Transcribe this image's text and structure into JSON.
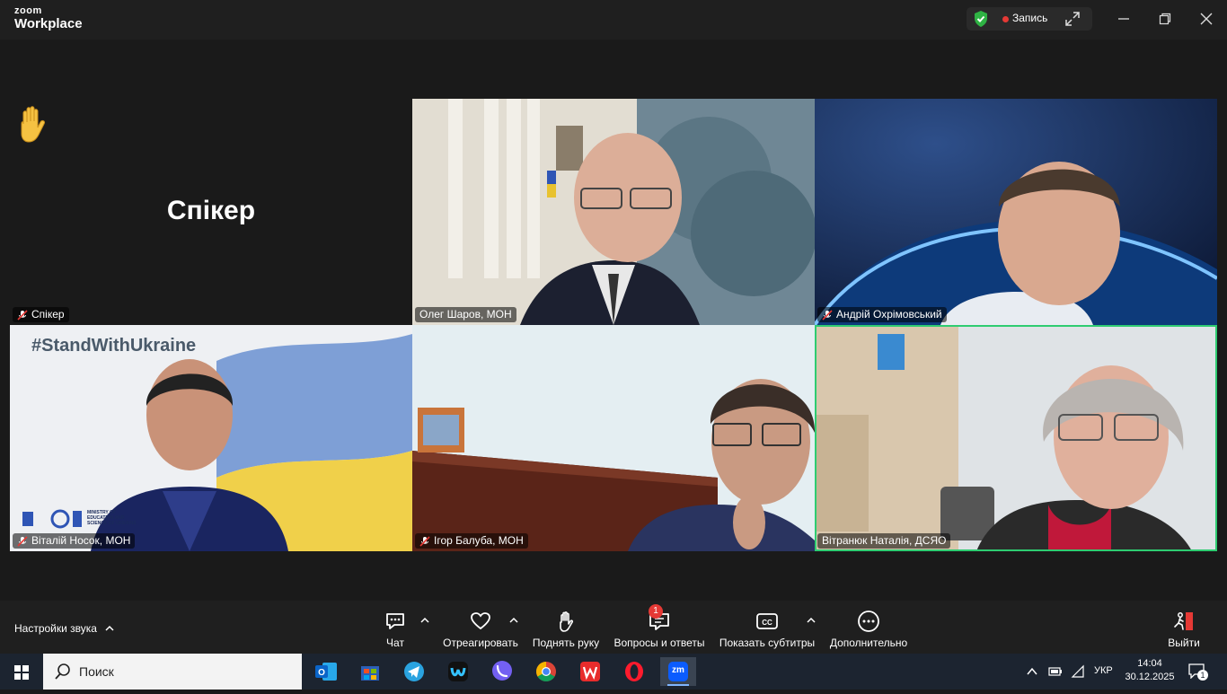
{
  "app": {
    "logo_line1": "zoom",
    "logo_line2": "Workplace",
    "recording_label": "Запись"
  },
  "speaker_tile": {
    "big_label": "Спікер",
    "name": "Спікер",
    "reaction": "raised-hand"
  },
  "participants": [
    {
      "name": "Олег Шаров, МОН",
      "muted": false
    },
    {
      "name": "Андрій Охрімовський",
      "muted": true
    },
    {
      "name": "Віталій Носок, МОН",
      "muted": true,
      "overlay_text": "#StandWithUkraine",
      "logo_text": "MINISTRY OF EDUCATION AND SCIENCE OF UKRAINE"
    },
    {
      "name": "Ігор Балуба, МОН",
      "muted": true
    },
    {
      "name": "Вітранюк Наталія, ДСЯО",
      "muted": false,
      "active_speaker": true
    }
  ],
  "controls": {
    "audio_settings": "Настройки звука",
    "chat": "Чат",
    "react": "Отреагировать",
    "raise_hand": "Поднять руку",
    "qa": "Вопросы и ответы",
    "qa_badge": "1",
    "captions": "Показать субтитры",
    "more": "Дополнительно",
    "leave": "Выйти"
  },
  "taskbar": {
    "search_placeholder": "Поиск",
    "language": "УКР",
    "time": "14:04",
    "date": "30.12.2025",
    "notification_count": "1",
    "zoom_app_label": "zm"
  },
  "colors": {
    "active_border": "#2ecc71",
    "record_dot": "#e53935",
    "shield": "#2fb344",
    "leave_red": "#e53935"
  }
}
